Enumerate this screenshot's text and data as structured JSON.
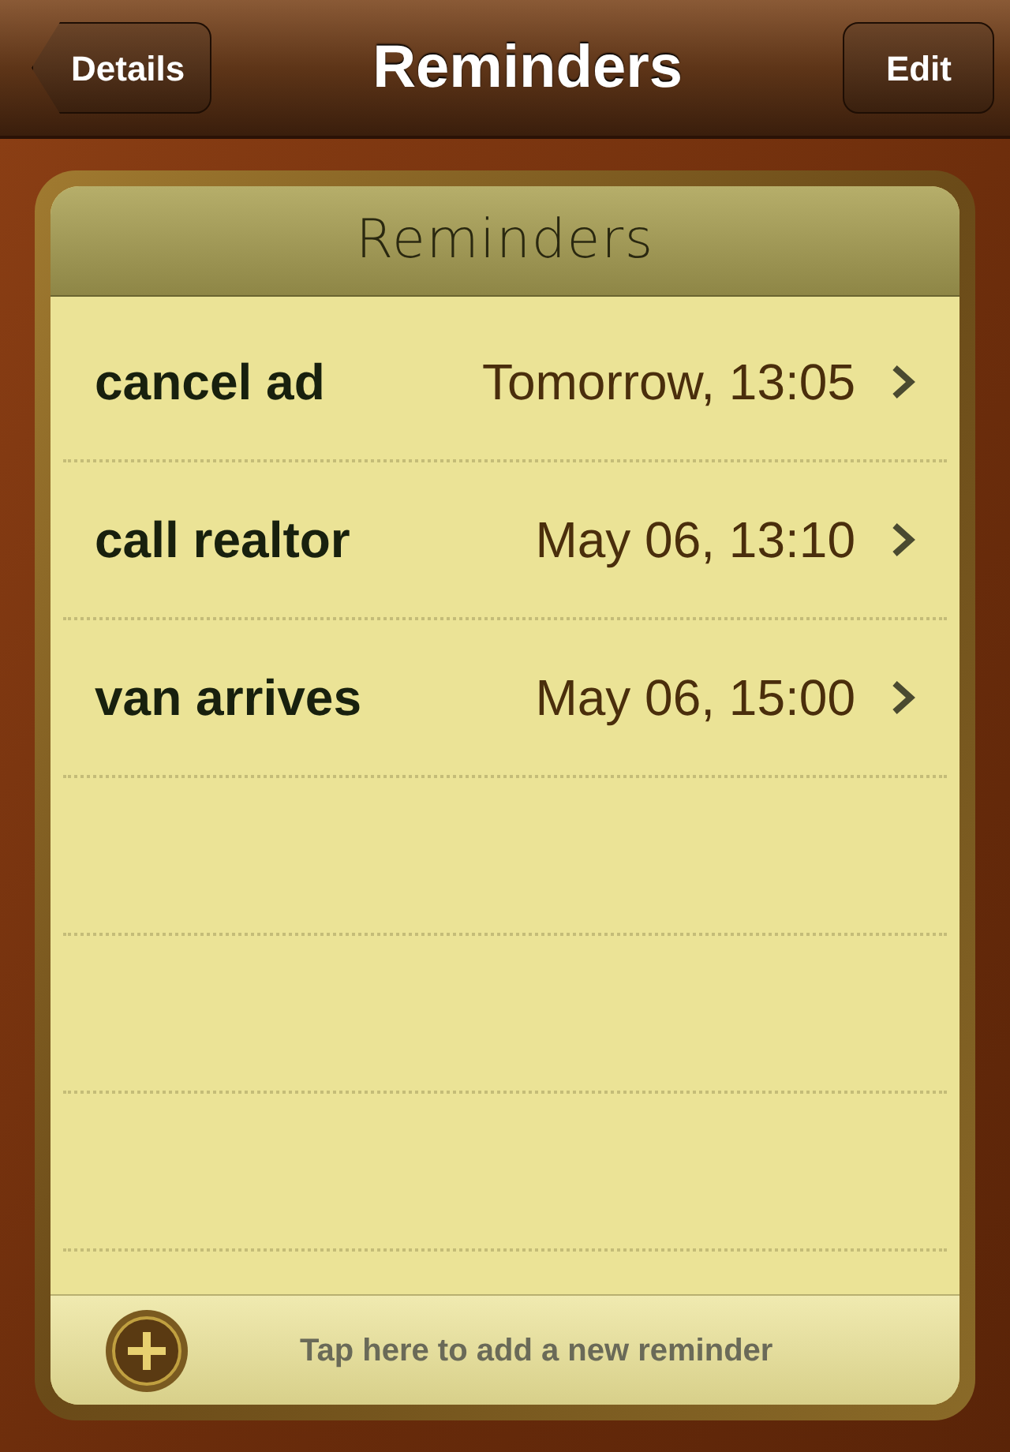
{
  "nav_bar": {
    "back_button": "Details",
    "title": "Reminders",
    "edit_button": "Edit"
  },
  "list": {
    "title": "Reminders",
    "reminders": [
      {
        "title": "cancel ad",
        "due": "Tomorrow, 13:05"
      },
      {
        "title": "call realtor",
        "due": "May 06, 13:10"
      },
      {
        "title": "van arrives",
        "due": "May 06, 15:00"
      }
    ],
    "add_hint": "Tap here to add a new reminder"
  }
}
